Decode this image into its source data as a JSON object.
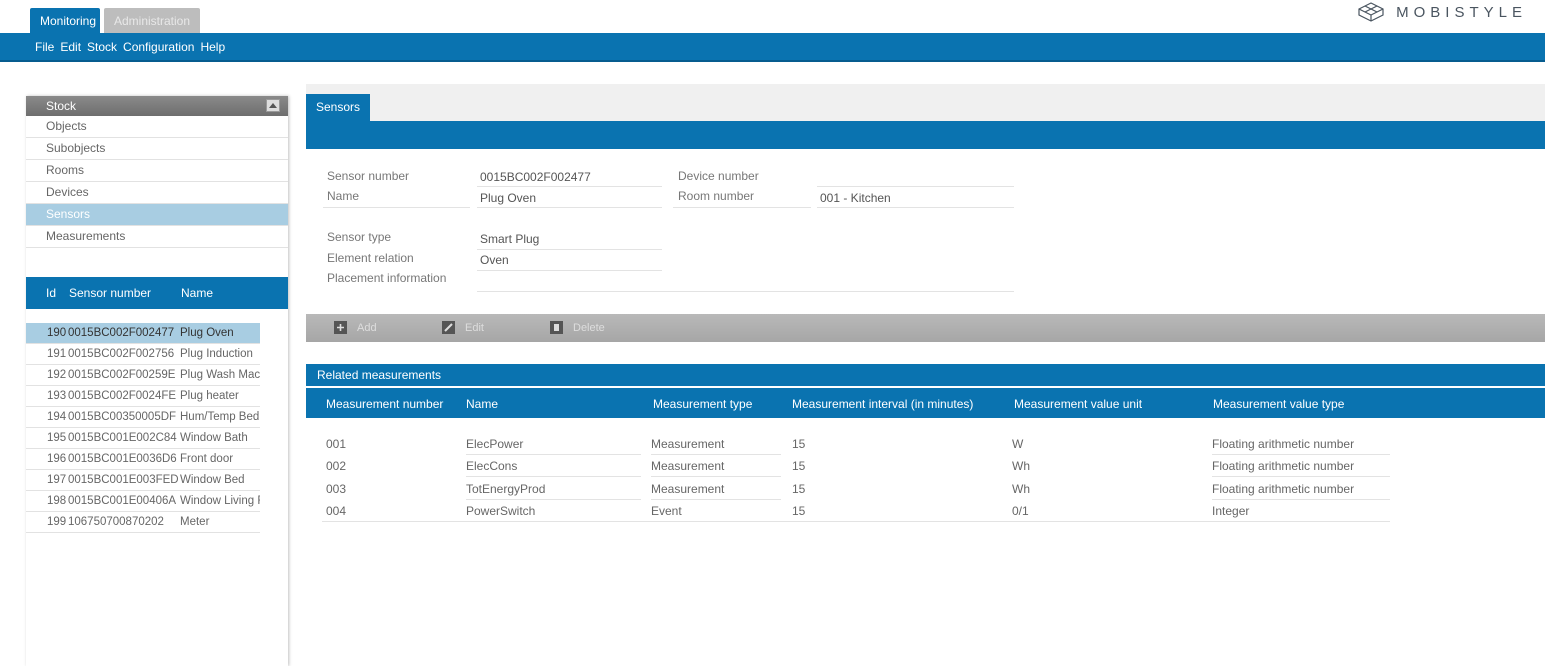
{
  "top_tabs": [
    "Monitoring",
    "Administration"
  ],
  "brand": "MOBISTYLE",
  "menu": [
    "File",
    "Edit",
    "Stock",
    "Configuration",
    "Help"
  ],
  "stock": {
    "title": "Stock",
    "items": [
      "Objects",
      "Subobjects",
      "Rooms",
      "Devices",
      "Sensors",
      "Measurements"
    ],
    "active": "Sensors"
  },
  "sensor_list": {
    "headers": [
      "Id",
      "Sensor number",
      "Name"
    ],
    "rows": [
      {
        "id": "190",
        "number": "0015BC002F002477",
        "name": "Plug Oven"
      },
      {
        "id": "191",
        "number": "0015BC002F002756",
        "name": "Plug Induction"
      },
      {
        "id": "192",
        "number": "0015BC002F00259E",
        "name": "Plug Wash Mac"
      },
      {
        "id": "193",
        "number": "0015BC002F0024FE",
        "name": "Plug heater"
      },
      {
        "id": "194",
        "number": "0015BC00350005DF",
        "name": "Hum/Temp Bed"
      },
      {
        "id": "195",
        "number": "0015BC001E002C84",
        "name": "Window Bath"
      },
      {
        "id": "196",
        "number": "0015BC001E0036D6",
        "name": "Front door"
      },
      {
        "id": "197",
        "number": "0015BC001E003FED",
        "name": "Window Bed"
      },
      {
        "id": "198",
        "number": "0015BC001E00406A",
        "name": "Window Living F"
      },
      {
        "id": "199",
        "number": "106750700870202",
        "name": "Meter"
      }
    ]
  },
  "detail_tab": "Sensors",
  "detail": {
    "sensor_number_label": "Sensor number",
    "sensor_number": "0015BC002F002477",
    "device_number_label": "Device number",
    "device_number": "",
    "name_label": "Name",
    "name": "Plug Oven",
    "room_number_label": "Room number",
    "room_number": "001 - Kitchen",
    "sensor_type_label": "Sensor type",
    "sensor_type": "Smart Plug",
    "element_relation_label": "Element relation",
    "element_relation": "Oven",
    "placement_label": "Placement information",
    "placement": ""
  },
  "toolbar": {
    "add": "Add",
    "edit": "Edit",
    "delete": "Delete"
  },
  "related": {
    "title": "Related measurements",
    "headers": [
      "Measurement number",
      "Name",
      "Measurement type",
      "Measurement interval (in minutes)",
      "Measurement value unit",
      "Measurement value type"
    ],
    "rows": [
      [
        "001",
        "ElecPower",
        "Measurement",
        "15",
        "W",
        "Floating arithmetic number"
      ],
      [
        "002",
        "ElecCons",
        "Measurement",
        "15",
        "Wh",
        "Floating arithmetic number"
      ],
      [
        "003",
        "TotEnergyProd",
        "Measurement",
        "15",
        "Wh",
        "Floating arithmetic number"
      ],
      [
        "004",
        "PowerSwitch",
        "Event",
        "15",
        "0/1",
        "Integer"
      ]
    ]
  }
}
